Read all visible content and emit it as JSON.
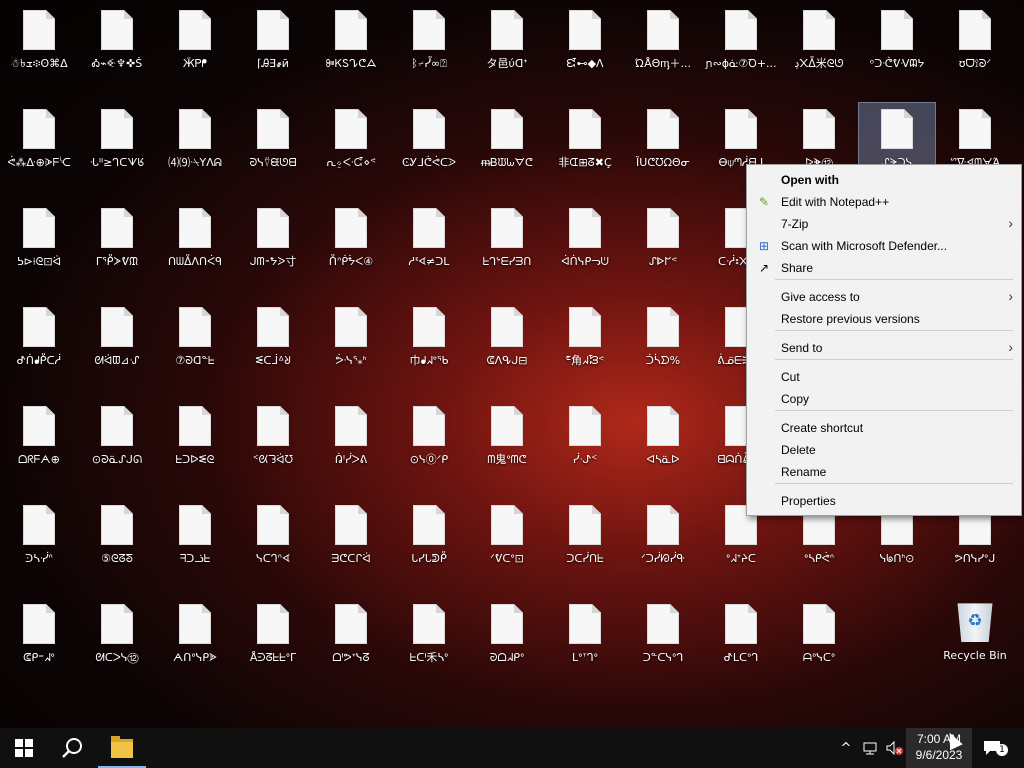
{
  "desktop": {
    "icons": [
      {
        "label": "☃৳ܫ፨ʘ⌘ᐃ"
      },
      {
        "label": "Ꭳ⌁ꔾ♆✜Ṡ"
      },
      {
        "label": "ӜᏢᖰ"
      },
      {
        "label": "⌈ᎯƎ҂ӣ"
      },
      {
        "label": "ꔼᏦᏚᖊᕦᗋ"
      },
      {
        "label": "ᛒ⌿ᓮ∞⍰"
      },
      {
        "label": "タ邑ύᗡᐩ"
      },
      {
        "label": "ᘿ⊷◆ᐱ"
      },
      {
        "label": "ΏÅΘᶆ＋..."
      },
      {
        "label": "ɲ∾ɸᓎ⑦Ꝺ+..."
      },
      {
        "label": "ڍ᙭ᐂ米ᘓᘎ"
      },
      {
        "label": "ᵒᑐᕨᕓᐺᗼᔭ"
      },
      {
        "label": "ʊᗜ⟟ᘐᐟ"
      },
      {
        "label": "ᕚ⁂ᐏ⊕ᗇᖴᔍ"
      },
      {
        "label": "ᒜᐦ≥ᒉᑕᗐᖉ"
      },
      {
        "label": "⑷⑼ᐧ⍀ΥΛᕱ"
      },
      {
        "label": "ᘒᓭ⍢ᙙᘎᗺ"
      },
      {
        "label": "ᕆ⍚ᑅᘹ⋄ᕝ"
      },
      {
        "label": "ϾᎩᒧᕧᕚᑕᐷ"
      },
      {
        "label": "ᵯᏴᙡᘈᗊᕦ"
      },
      {
        "label": "非ᗭ⊞ᘔ✖Ç"
      },
      {
        "label": "ȈᑌᕦᘮᘯΘᓂ"
      },
      {
        "label": "Ꮎ⍦ᘉᓲᗺᒧ"
      },
      {
        "label": "ᐅᗙ⑫"
      },
      {
        "label": "ᔑᗒᑐᓭ"
      },
      {
        "label": "ᔥᐍᗏᗶᗄΆ"
      },
      {
        "label": "ᕊ⊳⟊ᘓ⊡ᐛ"
      },
      {
        "label": "ᒥᕾᗆᕓᙢ"
      },
      {
        "label": "ᑎᗯᐂᐱᑎᐹᑫ"
      },
      {
        "label": "ᒍᗰ⁃ᖬᐷ寸"
      },
      {
        "label": "ᑍᐢᑮᖭᐸ④"
      },
      {
        "label": "ᓱᓫᗏ≠ᑐᒪ"
      },
      {
        "label": "ᖶᒉᔾᗴᓯᗱᑎ"
      },
      {
        "label": "ᐋᑏᓭᑭᓓᕫ"
      },
      {
        "label": "ᔑᐈᖸᕝ"
      },
      {
        "label": "ᑕᓾ꠩᙭ᖡᓮ"
      },
      {
        "label": "ᕷᑏᖱᑬᑕᓲ"
      },
      {
        "label": "ᘛᐛᗵ⊿ᔙ"
      },
      {
        "label": "⑦ᘐᗡᓐᖶ"
      },
      {
        "label": "ᓬᑕᒨᐞᖈ"
      },
      {
        "label": "ᕘᓶᕐ⁎ᑋ"
      },
      {
        "label": "巾ᖱᖽᐤᖃ"
      },
      {
        "label": "ᕳᐱᕴᒍ⊟"
      },
      {
        "label": "ᖟ角ᖽᘽᕝ"
      },
      {
        "label": "ᑑᓵᗤ%"
      },
      {
        "label": "ᕖᓆᗴᙋ᙮⊗"
      },
      {
        "label": "ᗝᖇᖴᗅ⊕"
      },
      {
        "label": "⊙ᘐᓏᔑᒍᘏ"
      },
      {
        "label": "ᖶᑐᐅᓬᘓ"
      },
      {
        "label": "ᑉᘡᘊᐛᘮ"
      },
      {
        "label": "ᕣᑊᓰᐳᕕ"
      },
      {
        "label": "⊙ᓭ⓪ᐟᑭ"
      },
      {
        "label": "ᗰ鬼ᐤᗰᕦ"
      },
      {
        "label": "ᓰᐧᖌᑉ"
      },
      {
        "label": "ᐊᓴᓏᐅ"
      },
      {
        "label": "ᗺᗣᑏᕔᑎᓭ"
      },
      {
        "label": "ᑔᓴᓺᐢ"
      },
      {
        "label": "⑤ᘓᘔᘕ"
      },
      {
        "label": "ᖷᑐᓘᖶ"
      },
      {
        "label": "ᓭᑕᒉᐢᗏ"
      },
      {
        "label": "ᗱᕦᑕᒋᐛ"
      },
      {
        "label": "ᒐᓯᒐᕲᑬ"
      },
      {
        "label": "ᐟᕓᑕᐤ⊡"
      },
      {
        "label": "ᑐᑕᓰᑎᖶ"
      },
      {
        "label": "ᐟᑐᓰᘗᓰᑵ"
      },
      {
        "label": "ᐤᖽᐩᔨᑕ"
      },
      {
        "label": "ᐤᓴᑭᕚᐢ"
      },
      {
        "label": "ᓭᖚᑎᑋ⊙"
      },
      {
        "label": "ᕗᑎᓭᓯᐤᒍ"
      },
      {
        "label": "ᕳᑭ⁼ᖽᐤ"
      },
      {
        "label": "ᘛᑕᐳᓭ⑫"
      },
      {
        "label": "ᗅᑎᐤᓭᑭᗎ"
      },
      {
        "label": "ÅᕭᘔᖶᖶᐤΓ"
      },
      {
        "label": "ᗝᑊᕗᐩᓭᘔ"
      },
      {
        "label": "ᖶᑕᑊ禾ᓴᐤ"
      },
      {
        "label": "ᘒᗝᖽᑭᐤ"
      },
      {
        "label": "ᒪᐤᐪᒉᐤ"
      },
      {
        "label": "ᑐᓐᑕᓭᐤᒉ"
      },
      {
        "label": "ᕷᒪᑕᐤᒉ"
      },
      {
        "label": "ᗩᐤᓭᑕᐤ"
      }
    ],
    "recycle_bin": {
      "label": "Recycle Bin"
    }
  },
  "context_menu": {
    "items": [
      {
        "label": "Open with",
        "bold": true,
        "icon": "",
        "arrow": false
      },
      {
        "label": "Edit with Notepad++",
        "icon": "notepad-icon",
        "arrow": false
      },
      {
        "label": "7-Zip",
        "icon": "",
        "arrow": true
      },
      {
        "label": "Scan with Microsoft Defender...",
        "icon": "defender-icon",
        "arrow": false
      },
      {
        "label": "Share",
        "icon": "share-icon",
        "arrow": false
      },
      {
        "label": "Give access to",
        "icon": "",
        "arrow": true
      },
      {
        "label": "Restore previous versions",
        "icon": "",
        "arrow": false
      },
      {
        "label": "Send to",
        "icon": "",
        "arrow": true
      },
      {
        "label": "Cut",
        "icon": "",
        "arrow": false
      },
      {
        "label": "Copy",
        "icon": "",
        "arrow": false
      },
      {
        "label": "Create shortcut",
        "icon": "",
        "arrow": false
      },
      {
        "label": "Delete",
        "icon": "",
        "arrow": false
      },
      {
        "label": "Rename",
        "icon": "",
        "arrow": false
      },
      {
        "label": "Properties",
        "icon": "",
        "arrow": false
      }
    ],
    "submenu_arrow": "›"
  },
  "taskbar": {
    "clock_time": "7:00 AM",
    "clock_date": "9/6/2023",
    "notification_count": "1",
    "tray_chevron": "^"
  },
  "colors": {
    "menu_bg": "#f2f2f2",
    "taskbar_bg": "#101010",
    "selection": "#7896be"
  }
}
